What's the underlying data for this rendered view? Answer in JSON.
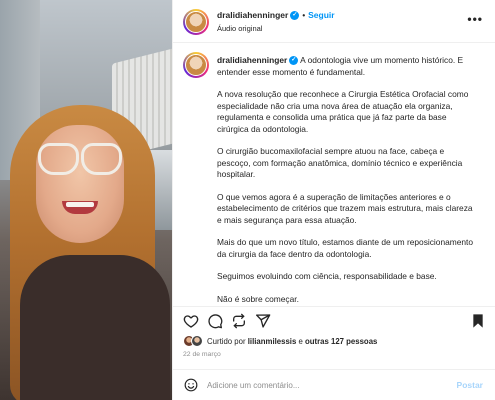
{
  "post": {
    "username": "dralidiahenninger",
    "follow_label": "Seguir",
    "audio_label": "Áudio original",
    "more_label": "•••"
  },
  "caption": {
    "username": "dralidiahenninger",
    "lead": "A odontologia vive um momento histórico. E entender esse momento é fundamental.",
    "paragraphs": [
      "A nova resolução que reconhece a Cirurgia Estética Orofacial como especialidade não cria uma nova área de atuação ela organiza, regulamenta e consolida uma prática que já faz parte da base cirúrgica da odontologia.",
      "O cirurgião bucomaxilofacial sempre atuou na face, cabeça e pescoço, com formação anatômica, domínio técnico e experiência hospitalar.",
      "O que vemos agora é a superação de limitações anteriores e o estabelecimento de critérios que trazem mais estrutura, mais clareza e mais segurança para essa atuação.",
      "Mais do que um novo título, estamos diante de um reposicionamento da cirurgia da face dentro da odontologia.",
      "Seguimos evoluindo com ciência, responsabilidade e base.",
      "Não é sobre começar."
    ]
  },
  "likes": {
    "prefix": "Curtido por",
    "user": "lilianmilessis",
    "connector": "e",
    "others": "outras 127 pessoas"
  },
  "date": "22 de março",
  "comment": {
    "placeholder": "Adicione um comentário...",
    "post_label": "Postar"
  },
  "icons": {
    "like": "heart-icon",
    "comment": "comment-icon",
    "repost": "repost-icon",
    "share": "share-icon",
    "save": "bookmark-icon",
    "emoji": "emoji-icon",
    "more": "more-icon"
  },
  "colors": {
    "accent": "#0095f6",
    "post_disabled": "#a8d5fb",
    "muted": "#8e8e8e",
    "text": "#262626"
  }
}
